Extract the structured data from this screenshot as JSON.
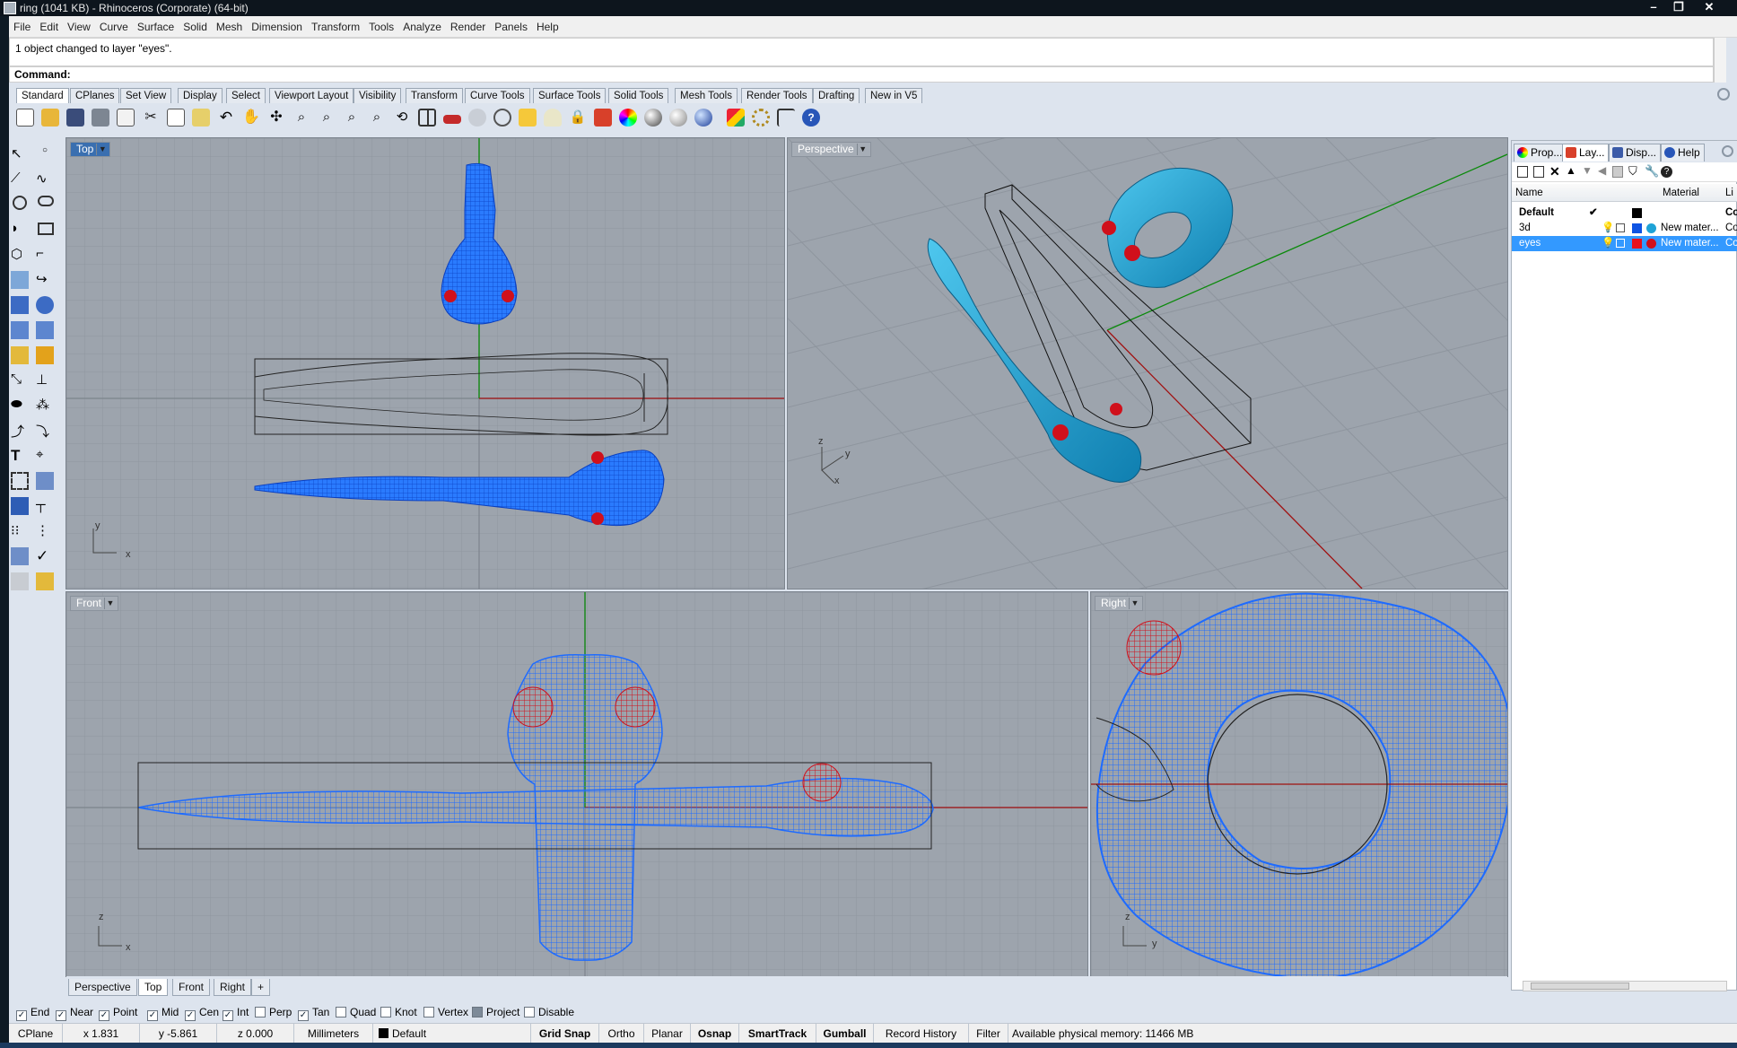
{
  "window": {
    "title": "ring (1041 KB) - Rhinoceros (Corporate) (64-bit)",
    "minimize": "–",
    "maximize": "❐",
    "close": "✕"
  },
  "menu": [
    "File",
    "Edit",
    "View",
    "Curve",
    "Surface",
    "Solid",
    "Mesh",
    "Dimension",
    "Transform",
    "Tools",
    "Analyze",
    "Render",
    "Panels",
    "Help"
  ],
  "command": {
    "history": "1 object changed to layer \"eyes\".",
    "prompt": "Command:"
  },
  "toolbar_tabs": [
    "Standard",
    "CPlanes",
    "Set View",
    "Display",
    "Select",
    "Viewport Layout",
    "Visibility",
    "Transform",
    "Curve Tools",
    "Surface Tools",
    "Solid Tools",
    "Mesh Tools",
    "Render Tools",
    "Drafting",
    "New in V5"
  ],
  "toolbar_tabs_active": "Standard",
  "toolbar_icons": [
    "new-icon",
    "open-icon",
    "save-icon",
    "print-icon",
    "import-icon",
    "cut-icon",
    "copy-icon",
    "paste-icon",
    "undo-icon",
    "pan-icon",
    "rotate-view-icon",
    "zoom-dynamic-icon",
    "zoom-window-icon",
    "zoom-extents-icon",
    "zoom-selected-icon",
    "four-view-icon",
    "car-icon",
    "options-icon",
    "camera-icon",
    "select-points-icon",
    "light-icon",
    "lock-icon",
    "layer-icon",
    "color-wheel-icon",
    "render-shaded-icon",
    "render-ghost-icon",
    "render-sphere-icon",
    "filter-icon",
    "settings-gear-icon",
    "dimension-icon",
    "help-icon"
  ],
  "viewports": {
    "top": {
      "label": "Top",
      "axis_x": "x",
      "axis_y": "y"
    },
    "perspective": {
      "label": "Perspective",
      "axis_x": "x",
      "axis_y": "y",
      "axis_z": "z"
    },
    "front": {
      "label": "Front",
      "axis_x": "x",
      "axis_z": "z"
    },
    "right": {
      "label": "Right",
      "axis_y": "y",
      "axis_z": "z"
    }
  },
  "viewport_tabs": [
    "Perspective",
    "Top",
    "Front",
    "Right",
    "+"
  ],
  "viewport_tabs_active": "Top",
  "osnaps": [
    {
      "label": "End",
      "checked": true
    },
    {
      "label": "Near",
      "checked": true
    },
    {
      "label": "Point",
      "checked": true
    },
    {
      "label": "Mid",
      "checked": true
    },
    {
      "label": "Cen",
      "checked": true
    },
    {
      "label": "Int",
      "checked": true
    },
    {
      "label": "Perp",
      "checked": false
    },
    {
      "label": "Tan",
      "checked": true
    },
    {
      "label": "Quad",
      "checked": false
    },
    {
      "label": "Knot",
      "checked": false
    },
    {
      "label": "Vertex",
      "checked": false
    },
    {
      "label": "Project",
      "checked": true
    },
    {
      "label": "Disable",
      "checked": false
    }
  ],
  "status": {
    "cplane": "CPlane",
    "x": "x 1.831",
    "y": "y -5.861",
    "z": "z 0.000",
    "units": "Millimeters",
    "layer": "Default",
    "grid_snap": "Grid Snap",
    "ortho": "Ortho",
    "planar": "Planar",
    "osnap": "Osnap",
    "smarttrack": "SmartTrack",
    "gumball": "Gumball",
    "record_history": "Record History",
    "filter": "Filter",
    "memory": "Available physical memory: 11466 MB"
  },
  "panel": {
    "tabs": [
      "Prop...",
      "Lay...",
      "Disp...",
      "Help"
    ],
    "active_tab": "Lay...",
    "columns": {
      "name": "Name",
      "material": "Material",
      "linetype": "Li"
    },
    "layers": [
      {
        "name": "Default",
        "check": "✔",
        "color": "#000000",
        "material": "",
        "linetype": "Co",
        "selected": false
      },
      {
        "name": "3d",
        "check": "",
        "color": "#0f54e3",
        "material": "New mater...",
        "linetype": "Co",
        "selected": false
      },
      {
        "name": "eyes",
        "check": "",
        "color": "#e8101a",
        "material": "New mater...",
        "linetype": "Co",
        "selected": true
      }
    ]
  },
  "colors": {
    "model_blue": "#1e6bff",
    "render_cyan": "#1fa3d7",
    "eye_red": "#d0101b",
    "viewport_bg": "#9da4ad",
    "axis_red": "#a01010",
    "axis_green": "#0b8a0b",
    "active_label": "#3a6fb0"
  }
}
